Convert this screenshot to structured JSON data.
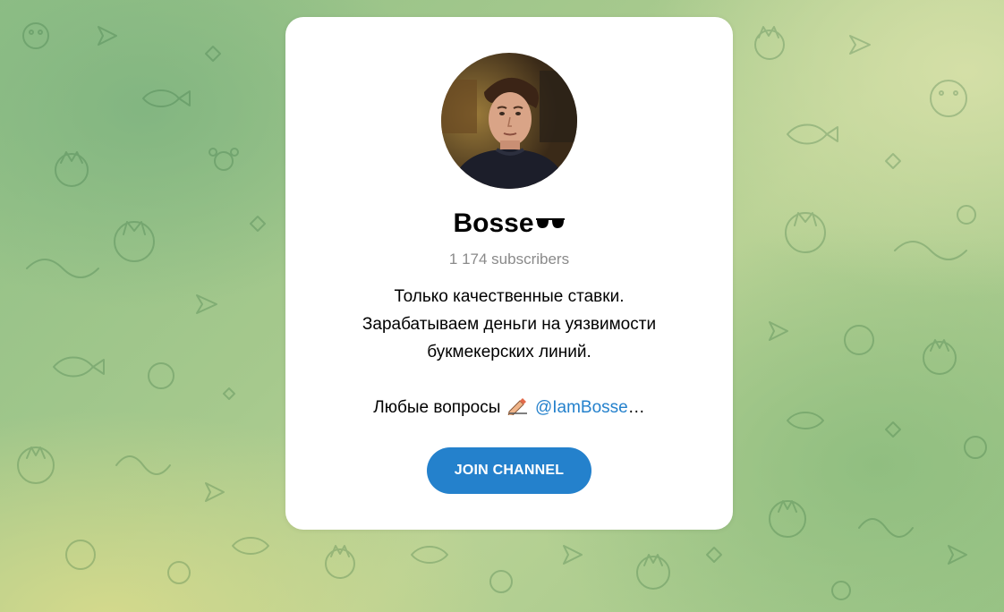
{
  "channel": {
    "title": "Bosse",
    "title_emoji": "sunglasses-icon",
    "subscribers": "1 174 subscribers",
    "description_lines": [
      "Только качественные ставки.",
      "Зарабатываем деньги на уязвимости",
      "букмекерских линий."
    ],
    "contact_prefix": "Любые вопросы",
    "contact_emoji": "writing-hand-icon",
    "contact_mention": "@IamBosse",
    "contact_suffix": "…"
  },
  "join_button": {
    "label": "JOIN CHANNEL"
  },
  "colors": {
    "accent": "#2481cc",
    "card_bg": "#ffffff",
    "muted_text": "#8a8a8a",
    "background_green": "#8fbf86",
    "background_yellow": "#d6da8c"
  }
}
